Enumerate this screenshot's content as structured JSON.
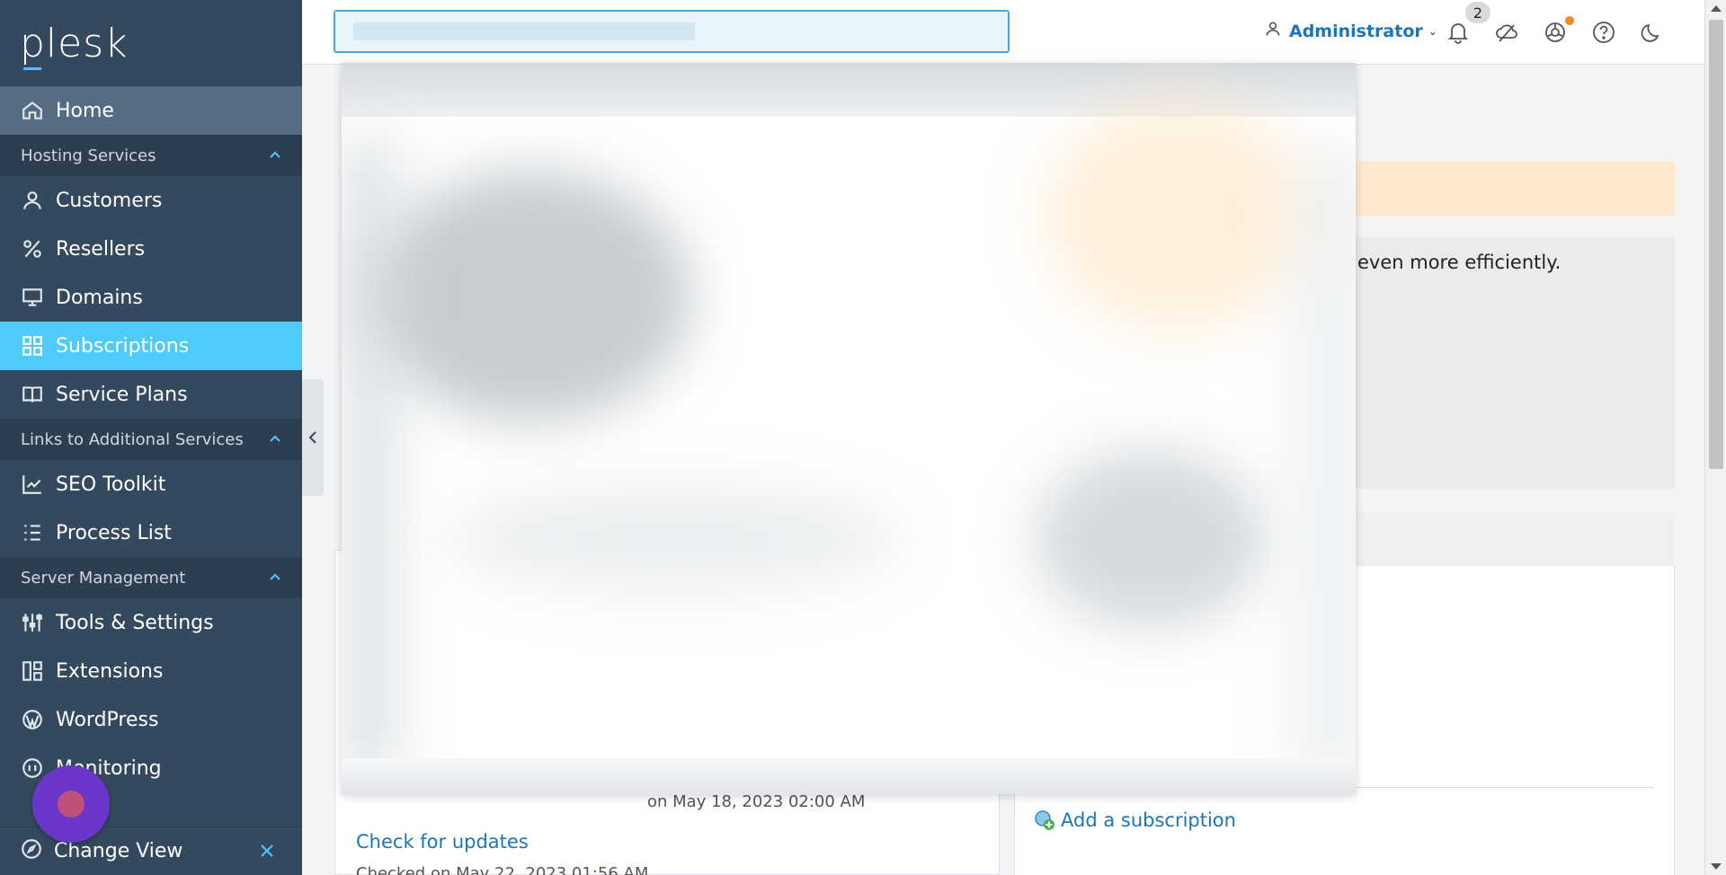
{
  "brand": {
    "logo": "plesk"
  },
  "header": {
    "search": {
      "value": "",
      "placeholder": ""
    },
    "user_label": "Administrator",
    "notifications_count": "2",
    "icons": [
      "user-icon",
      "bell-icon",
      "cloud-icon",
      "extensions-icon",
      "help-icon",
      "moon-icon"
    ]
  },
  "sidebar": {
    "home": "Home",
    "sections": [
      {
        "label": "Hosting Services",
        "items": [
          "Customers",
          "Resellers",
          "Domains",
          "Subscriptions",
          "Service Plans"
        ]
      },
      {
        "label": "Links to Additional Services",
        "items": [
          "SEO Toolkit",
          "Process List"
        ]
      },
      {
        "label": "Server Management",
        "items": [
          "Tools & Settings",
          "Extensions",
          "WordPress",
          "Monitoring"
        ]
      }
    ],
    "active_item": "Subscriptions",
    "change_view": "Change View"
  },
  "main": {
    "info_text": "even more efficiently.",
    "update_date": "on May 18, 2023 02:00 AM",
    "check_updates": "Check for updates",
    "checked_on": "Checked on May 22, 2023 01:56 AM",
    "add_subscription": "Add a subscription"
  },
  "colors": {
    "sidebar_bg": "#34495e",
    "active_item": "#4fcbf9",
    "link": "#1b75bb",
    "notice": "#fde9cf"
  }
}
